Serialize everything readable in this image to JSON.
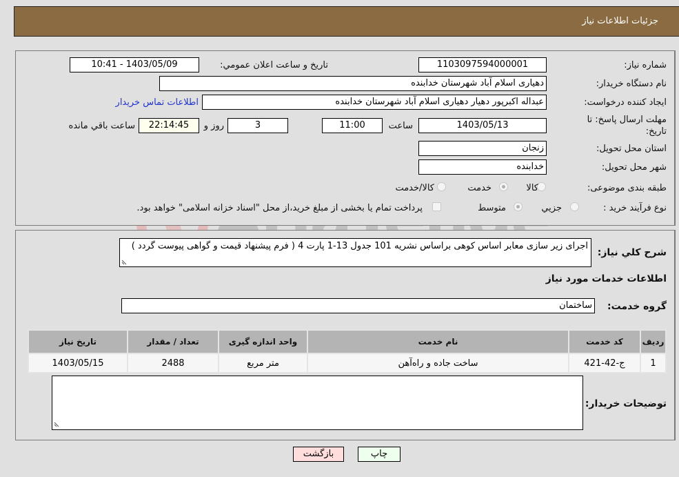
{
  "header": {
    "title": "جزئیات اطلاعات نیاز"
  },
  "need_info": {
    "need_number_label": "شماره نیاز:",
    "need_number": "1103097594000001",
    "announce_label": "تاریخ و ساعت اعلان عمومي:",
    "announce_value": "1403/05/09 - 10:41",
    "buyer_org_label": "نام دستگاه خریدار:",
    "buyer_org": "دهیاری اسلام آباد شهرستان خدابنده",
    "creator_label": "ایجاد کننده درخواست:",
    "creator": "عبداله اکبرپور دهیار دهیاری اسلام آباد شهرستان خدابنده",
    "contact_link": "اطلاعات تماس خریدار",
    "deadline_label_line1": "مهلت ارسال پاسخ: تا",
    "deadline_label_line2": "تاریخ:",
    "deadline_date": "1403/05/13",
    "time_label": "ساعت",
    "deadline_time": "11:00",
    "days_value": "3",
    "days_label": "روز و",
    "remaining_time": "22:14:45",
    "remaining_label": "ساعت باقي مانده",
    "province_label": "استان محل تحویل:",
    "province": "زنجان",
    "city_label": "شهر محل تحویل:",
    "city": "خدابنده",
    "category_label": "طبقه بندی موضوعی:",
    "category_options": [
      {
        "label": "کالا",
        "checked": false
      },
      {
        "label": "خدمت",
        "checked": true
      },
      {
        "label": "کالا/خدمت",
        "checked": false
      }
    ],
    "process_label": "نوع فرآیند خرید :",
    "process_options": [
      {
        "label": "جزيي",
        "checked": false
      },
      {
        "label": "متوسط",
        "checked": true
      }
    ],
    "treasury_checkbox_label": "پرداخت تمام یا بخشی از مبلغ خرید،از محل \"اسناد خزانه اسلامی\" خواهد بود.",
    "treasury_checked": false
  },
  "details": {
    "description_label": "شرح کلي نیاز:",
    "description": "اجرای زیر سازی معابر اساس کوهی براساس نشریه 101 جدول 13-1 پارت 4 ( فرم پیشنهاد قیمت و گواهی پیوست گردد )",
    "services_heading": "اطلاعات خدمات مورد نیاز",
    "service_group_label": "گروه خدمت:",
    "service_group": "ساختمان",
    "table": {
      "headers": [
        "ردیف",
        "کد خدمت",
        "نام خدمت",
        "واحد اندازه گیری",
        "تعداد / مقدار",
        "تاریخ نیاز"
      ],
      "rows": [
        [
          "1",
          "ج-42-421",
          "ساخت جاده و راه‌آهن",
          "متر مربع",
          "2488",
          "1403/05/15"
        ]
      ]
    },
    "buyer_notes_label": "توضیحات خریدار:",
    "buyer_notes": ""
  },
  "buttons": {
    "print": "چاپ",
    "back": "بازگشت"
  },
  "watermark": {
    "text": "AriaTender.neT"
  },
  "colors": {
    "header_bg": "#8b6c42",
    "back_btn_bg": "#ffdddd",
    "print_btn_bg": "#eeffee",
    "link": "#2233cc"
  }
}
